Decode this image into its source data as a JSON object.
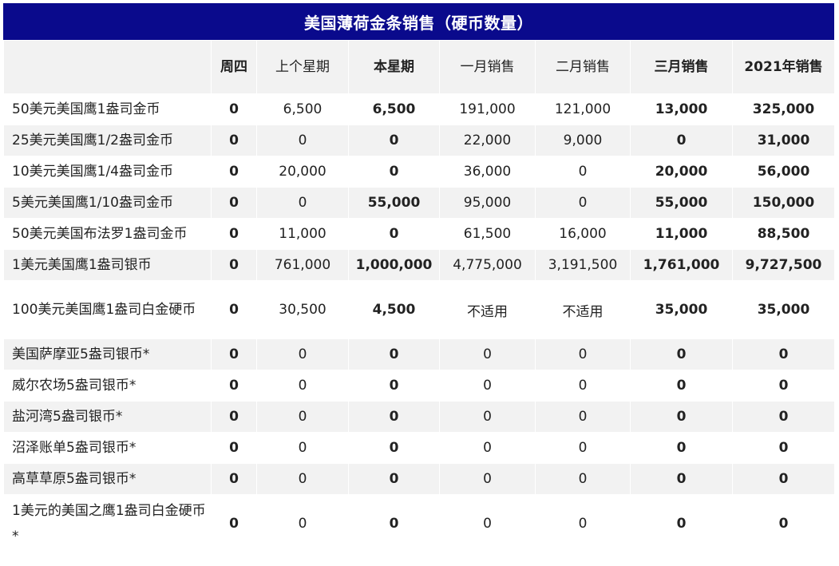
{
  "title": "美国薄荷金条销售（硬币数量）",
  "headers": [
    "",
    "周四",
    "上个星期",
    "本星期",
    "一月销售",
    "二月销售",
    "三月销售",
    "2021年销售"
  ],
  "rows": [
    [
      "50美元美国鹰1盎司金币",
      "0",
      "6,500",
      "6,500",
      "191,000",
      "121,000",
      "13,000",
      "325,000"
    ],
    [
      "25美元美国鹰1/2盎司金币",
      "0",
      "0",
      "0",
      "22,000",
      "9,000",
      "0",
      "31,000"
    ],
    [
      "10美元美国鹰1/4盎司金币",
      "0",
      "20,000",
      "0",
      "36,000",
      "0",
      "20,000",
      "56,000"
    ],
    [
      "5美元美国鹰1/10盎司金币",
      "0",
      "0",
      "55,000",
      "95,000",
      "0",
      "55,000",
      "150,000"
    ],
    [
      "50美元美国布法罗1盎司金币",
      "0",
      "11,000",
      "0",
      "61,500",
      "16,000",
      "11,000",
      "88,500"
    ],
    [
      "1美元美国鹰1盎司银币",
      "0",
      "761,000",
      "1,000,000",
      "4,775,000",
      "3,191,500",
      "1,761,000",
      "9,727,500"
    ],
    [
      "100美元美国鹰1盎司白金硬币",
      "0",
      "30,500",
      "4,500",
      "不适用",
      "不适用",
      "35,000",
      "35,000"
    ],
    [
      "美国萨摩亚5盎司银币*",
      "0",
      "0",
      "0",
      "0",
      "0",
      "0",
      "0"
    ],
    [
      "威尔农场5盎司银币*",
      "0",
      "0",
      "0",
      "0",
      "0",
      "0",
      "0"
    ],
    [
      "盐河湾5盎司银币*",
      "0",
      "0",
      "0",
      "0",
      "0",
      "0",
      "0"
    ],
    [
      "沼泽账单5盎司银币*",
      "0",
      "0",
      "0",
      "0",
      "0",
      "0",
      "0"
    ],
    [
      "高草草原5盎司银币*",
      "0",
      "0",
      "0",
      "0",
      "0",
      "0",
      "0"
    ],
    [
      "1美元的美国之鹰1盎司白金硬币*",
      "0",
      "0",
      "0",
      "0",
      "0",
      "0",
      "0"
    ]
  ],
  "colors": {
    "title_bg": "#0a0a8c",
    "title_text": "#ffffff",
    "stripe": "#f2f2f2"
  }
}
